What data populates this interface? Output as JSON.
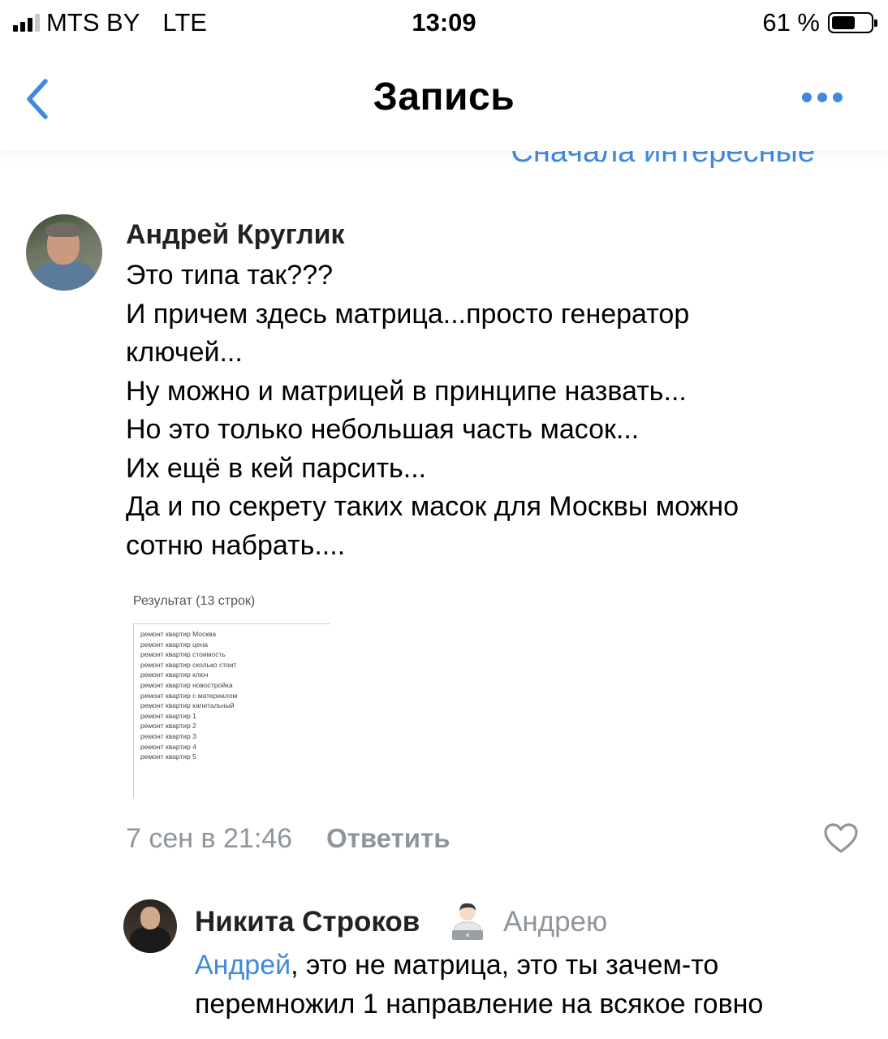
{
  "status_bar": {
    "carrier": "MTS BY",
    "network": "LTE",
    "time": "13:09",
    "battery_percent": "61 %",
    "battery_level": 0.61,
    "signal_bars": 3,
    "signal_total": 4
  },
  "nav": {
    "title": "Запись",
    "back_icon": "chevron-left-icon",
    "more_icon": "more-dots-icon",
    "sort_label_partial": "Сначала интересные"
  },
  "colors": {
    "accent": "#3f8ae0",
    "secondary_text": "#8f959c"
  },
  "comments": [
    {
      "author": "Андрей Круглик",
      "lines": [
        "Это типа так???",
        "И причем здесь матрица...просто генератор",
        "ключей...",
        "Ну можно и матрицей в принципе назвать...",
        "Но это только небольшая часть масок...",
        "Их ещё в кей парсить...",
        "Да и по секрету таких масок для Москвы можно",
        "сотню набрать...."
      ],
      "attachment": {
        "title": "Результат (13 строк)",
        "rows": [
          "ремонт квартир Москва",
          "ремонт квартир цена",
          "ремонт квартир стоимость",
          "ремонт квартир сколько стоит",
          "ремонт квартир ключ",
          "ремонт квартир новостройка",
          "ремонт квартир с материалом",
          "ремонт квартир капитальный",
          "ремонт квартир 1",
          "ремонт квартир 2",
          "ремонт квартир 3",
          "ремонт квартир 4",
          "ремонт квартир 5"
        ]
      },
      "date": "7 сен в 21:46",
      "reply_label": "Ответить",
      "like_icon": "heart-outline-icon"
    },
    {
      "author": "Никита Строков",
      "emoji": "👨🏻‍💻",
      "reply_to": "Андрею",
      "mention": "Андрей",
      "line1_rest": ", это не матрица, это ты зачем-то",
      "line2": "перемножил 1 направление на всякое говно"
    }
  ]
}
